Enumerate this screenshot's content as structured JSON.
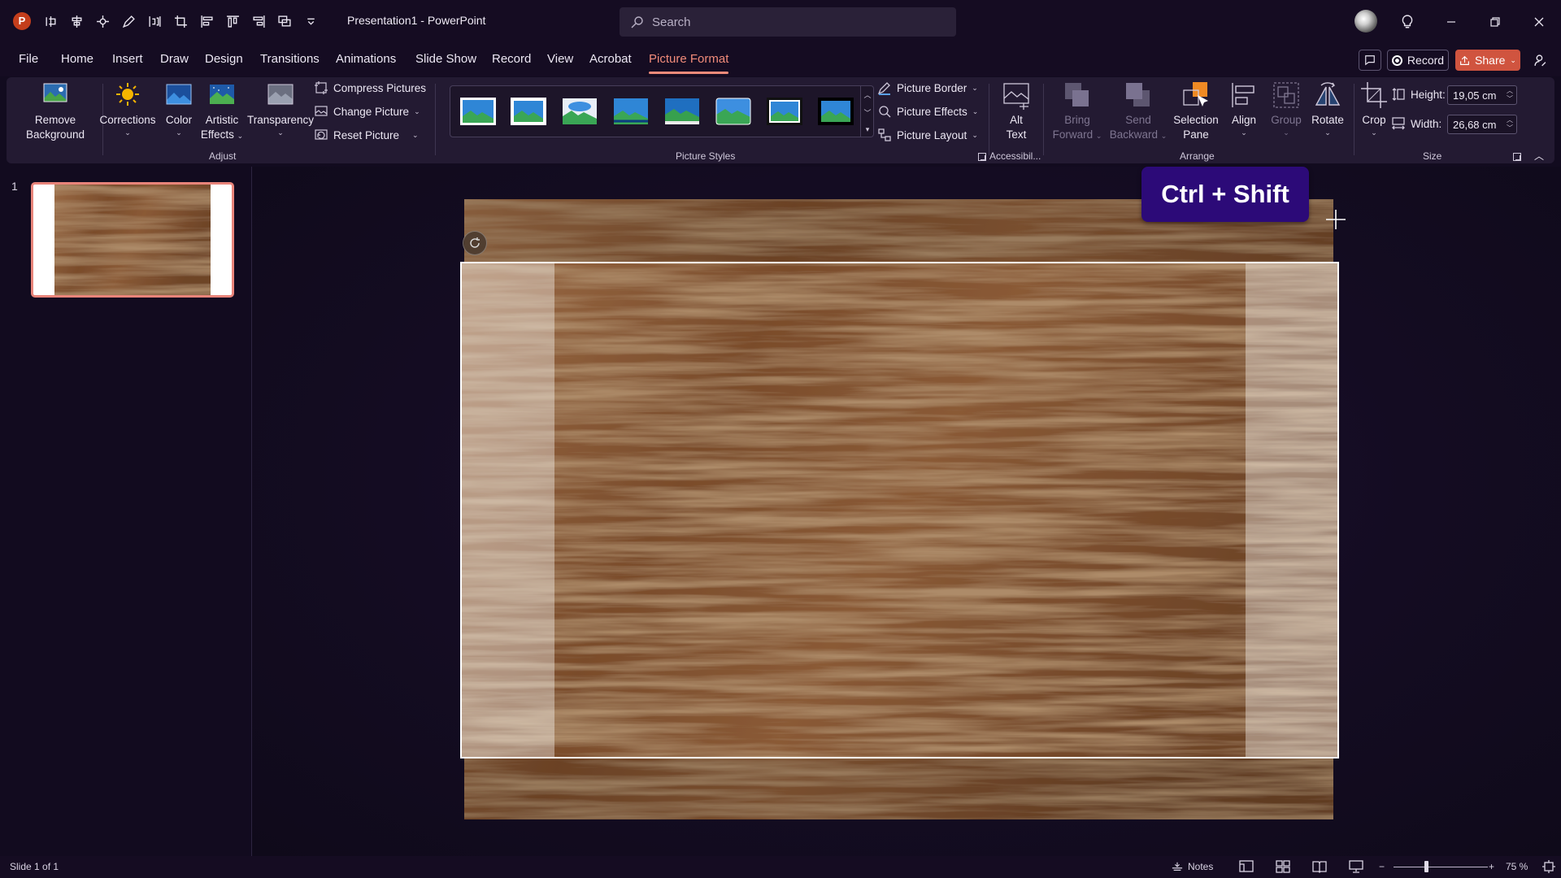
{
  "app": {
    "logo_letter": "P",
    "doc_title": "Presentation1  -  PowerPoint",
    "search_placeholder": "Search"
  },
  "quick_access": [
    "shape-icon",
    "align-center-icon",
    "node-icon",
    "pen-icon",
    "distribute-icon",
    "crop-icon",
    "align-left-icon",
    "align-top-icon",
    "align-right-icon",
    "group-icon",
    "customize-icon"
  ],
  "tabs": [
    {
      "label": "File"
    },
    {
      "label": "Home"
    },
    {
      "label": "Insert"
    },
    {
      "label": "Draw"
    },
    {
      "label": "Design"
    },
    {
      "label": "Transitions"
    },
    {
      "label": "Animations"
    },
    {
      "label": "Slide Show"
    },
    {
      "label": "Record"
    },
    {
      "label": "View"
    },
    {
      "label": "Acrobat"
    },
    {
      "label": "Picture Format"
    }
  ],
  "active_tab": "Picture Format",
  "header_buttons": {
    "record": "Record",
    "share": "Share"
  },
  "ribbon": {
    "adjust": {
      "label": "Adjust",
      "remove_background": [
        "Remove",
        "Background"
      ],
      "corrections": "Corrections",
      "color": "Color",
      "artistic_effects": [
        "Artistic",
        "Effects"
      ],
      "transparency": "Transparency",
      "compress": "Compress Pictures",
      "change": "Change Picture",
      "reset": "Reset Picture"
    },
    "picture_styles": {
      "label": "Picture Styles",
      "border": "Picture Border",
      "effects": "Picture Effects",
      "layout": "Picture Layout"
    },
    "accessibility": {
      "label": "Accessibil...",
      "alt_text": [
        "Alt",
        "Text"
      ]
    },
    "arrange": {
      "label": "Arrange",
      "bring_forward": [
        "Bring",
        "Forward"
      ],
      "send_backward": [
        "Send",
        "Backward"
      ],
      "selection_pane": [
        "Selection",
        "Pane"
      ],
      "align": "Align",
      "group": "Group",
      "rotate": "Rotate"
    },
    "size": {
      "label": "Size",
      "crop": "Crop",
      "height_label": "Height:",
      "height_value": "19,05 cm",
      "width_label": "Width:",
      "width_value": "26,68 cm"
    }
  },
  "slides_pane": {
    "slide_number": "1"
  },
  "overlay": {
    "shortcut": "Ctrl + Shift"
  },
  "status": {
    "slide_info": "Slide 1 of 1",
    "notes": "Notes",
    "zoom": "75 %",
    "zoom_level": 0.35
  },
  "colors": {
    "accent": "#f18b7a",
    "share": "#d0543f",
    "overlay": "#2c0a78"
  }
}
